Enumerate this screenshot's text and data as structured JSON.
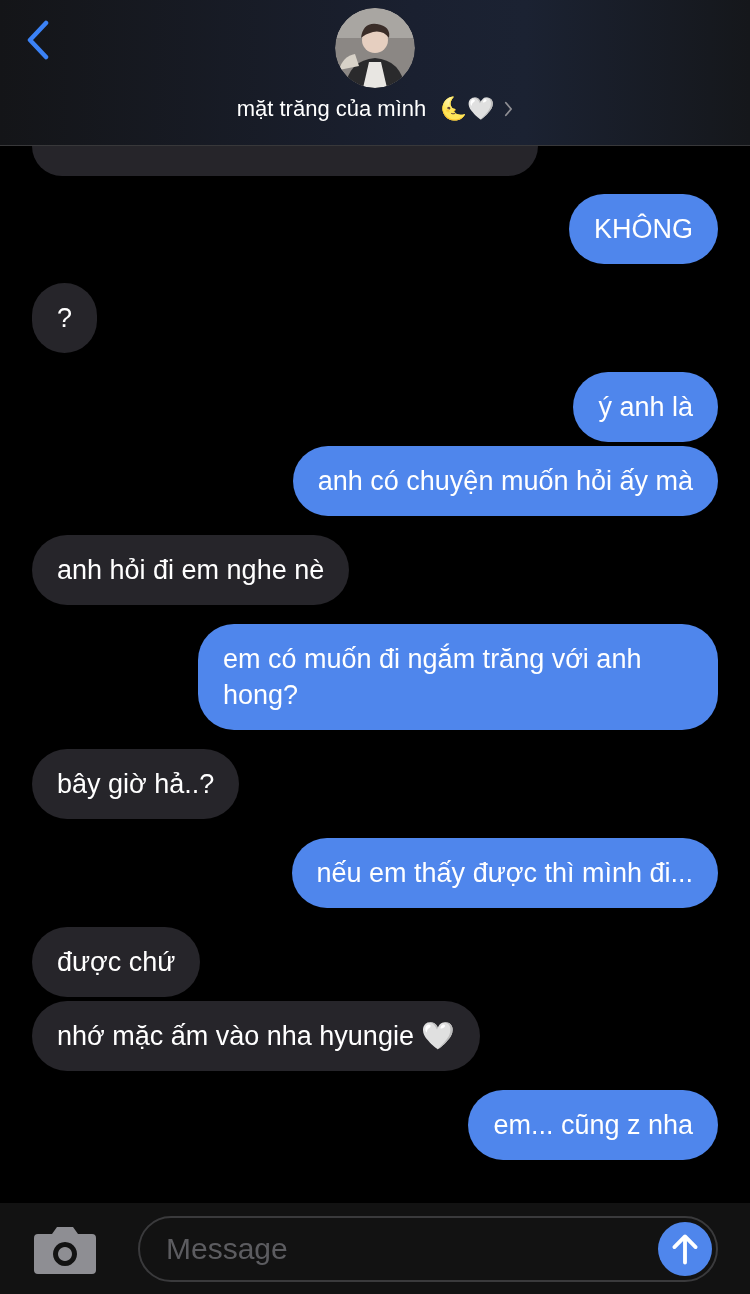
{
  "header": {
    "contact_name": "mặt trăng của mình",
    "emoji": "🌜🤍"
  },
  "messages": [
    {
      "kind": "sent",
      "text": "KHÔNG"
    },
    {
      "kind": "received",
      "text": "?"
    },
    {
      "kind": "sent",
      "text": "ý anh là"
    },
    {
      "kind": "sent",
      "text": "anh có chuyện muốn hỏi ấy mà"
    },
    {
      "kind": "received",
      "text": "anh hỏi đi em nghe nè"
    },
    {
      "kind": "sent",
      "text": "em có muốn đi ngắm trăng với anh hong?"
    },
    {
      "kind": "received",
      "text": "bây giờ hả..?"
    },
    {
      "kind": "sent",
      "text": "nếu em thấy được thì mình đi..."
    },
    {
      "kind": "received",
      "text": "được chứ"
    },
    {
      "kind": "received",
      "text": "nhớ mặc ấm vào nha hyungie 🤍"
    },
    {
      "kind": "sent",
      "text": "em... cũng z nha"
    }
  ],
  "composer": {
    "placeholder": "Message"
  }
}
